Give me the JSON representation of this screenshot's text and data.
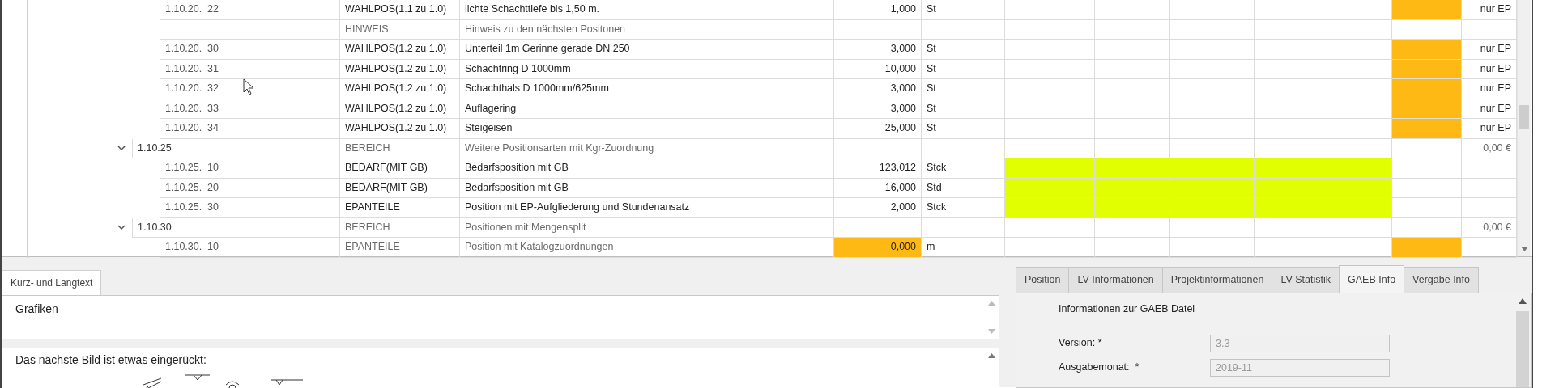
{
  "table": {
    "rows": [
      {
        "kind": "position",
        "number": "1.10.20.  22",
        "type": "WAHLPOS(1.1 zu 1.0)",
        "text": "lichte Schachttiefe bis 1,50 m.",
        "quantity": "1,000",
        "unit": "St",
        "price_highlighted": true,
        "total": "nur EP"
      },
      {
        "kind": "note",
        "type": "HINWEIS",
        "text": "Hinweis zu den nächsten Positonen"
      },
      {
        "kind": "position",
        "number": "1.10.20.  30",
        "type": "WAHLPOS(1.2 zu 1.0)",
        "text": "Unterteil 1m Gerinne gerade DN 250",
        "quantity": "3,000",
        "unit": "St",
        "price_highlighted": true,
        "total": "nur EP"
      },
      {
        "kind": "position",
        "number": "1.10.20.  31",
        "type": "WAHLPOS(1.2 zu 1.0)",
        "text": "Schachtring D 1000mm",
        "quantity": "10,000",
        "unit": "St",
        "price_highlighted": true,
        "total": "nur EP"
      },
      {
        "kind": "position",
        "number": "1.10.20.  32",
        "type": "WAHLPOS(1.2 zu 1.0)",
        "text": "Schachthals D 1000mm/625mm",
        "quantity": "3,000",
        "unit": "St",
        "price_highlighted": true,
        "total": "nur EP"
      },
      {
        "kind": "position",
        "number": "1.10.20.  33",
        "type": "WAHLPOS(1.2 zu 1.0)",
        "text": "Auflagering",
        "quantity": "3,000",
        "unit": "St",
        "price_highlighted": true,
        "total": "nur EP"
      },
      {
        "kind": "position",
        "number": "1.10.20.  34",
        "type": "WAHLPOS(1.2 zu 1.0)",
        "text": "Steigeisen",
        "quantity": "25,000",
        "unit": "St",
        "price_highlighted": true,
        "total": "nur EP"
      },
      {
        "kind": "group",
        "number": "1.10.25",
        "expanded": true,
        "type": "BEREICH",
        "text": "Weitere Positionsarten mit Kgr-Zuordnung",
        "total": "0,00 €"
      },
      {
        "kind": "position",
        "number": "1.10.25.  10",
        "type": "BEDARF(MIT GB)",
        "text": "Bedarfsposition mit GB",
        "quantity": "123,012",
        "unit": "Stck",
        "range_highlighted": true
      },
      {
        "kind": "position",
        "number": "1.10.25.  20",
        "type": "BEDARF(MIT GB)",
        "text": "Bedarfsposition mit GB",
        "quantity": "16,000",
        "unit": "Std",
        "range_highlighted": true
      },
      {
        "kind": "position",
        "number": "1.10.25.  30",
        "type": "EPANTEILE",
        "text": "Position mit EP-Aufgliederung und Stundenansatz",
        "quantity": "2,000",
        "unit": "Stck",
        "range_highlighted": true
      },
      {
        "kind": "group",
        "number": "1.10.30",
        "expanded": true,
        "type": "BEREICH",
        "text": "Positionen mit Mengensplit",
        "total": "0,00 €"
      },
      {
        "kind": "position",
        "number": "1.10.30.  10",
        "type": "EPANTEILE",
        "text": "Position mit Katalogzuordnungen",
        "dimmed": true,
        "quantity": "0,000",
        "quantity_highlighted": true,
        "unit": "m",
        "price_highlighted": true
      }
    ]
  },
  "text_panel": {
    "tabs": [
      {
        "label": "Kurz- und Langtext",
        "selected": true
      }
    ],
    "heading": "Grafiken",
    "body_text": "Das nächste Bild ist etwas eingerückt:"
  },
  "info_panel": {
    "tabs": [
      {
        "label": "Position",
        "selected": false
      },
      {
        "label": "LV Informationen",
        "selected": false
      },
      {
        "label": "Projektinformationen",
        "selected": false
      },
      {
        "label": "LV Statistik",
        "selected": false
      },
      {
        "label": "GAEB Info",
        "selected": true
      },
      {
        "label": "Vergabe Info",
        "selected": false
      }
    ],
    "heading": "Informationen zur GAEB Datei",
    "fields": [
      {
        "label": "Version: *",
        "value": "3.3",
        "disabled": true
      },
      {
        "label": "Ausgabemonat:  *",
        "value": "2019-11",
        "disabled": true
      }
    ]
  }
}
